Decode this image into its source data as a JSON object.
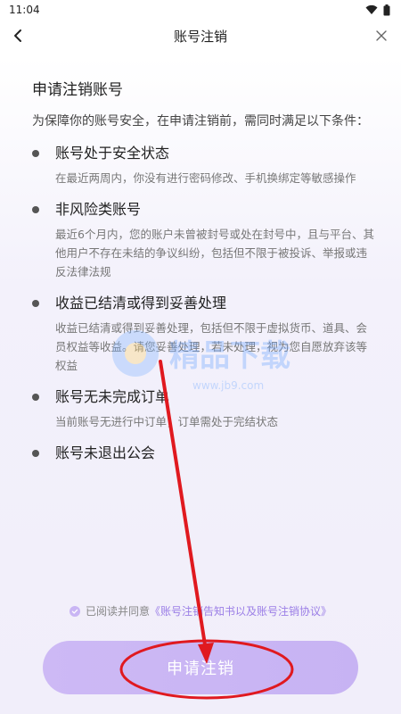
{
  "status_bar": {
    "time": "11:04"
  },
  "header": {
    "title": "账号注销"
  },
  "main": {
    "heading": "申请注销账号",
    "description": "为保障你的账号安全，在申请注销前，需同时满足以下条件：",
    "conditions": [
      {
        "title": "账号处于安全状态",
        "desc": "在最近两周内，你没有进行密码修改、手机换绑定等敏感操作"
      },
      {
        "title": "非风险类账号",
        "desc": "最近6个月内，您的账户未曾被封号或处在封号中，且与平台、其他用户不存在未结的争议纠纷，包括但不限于被投诉、举报或违反法律法规"
      },
      {
        "title": "收益已结清或得到妥善处理",
        "desc": "收益已结清或得到妥善处理，包括但不限于虚拟货币、道具、会员权益等收益。请您妥善处理，若未处理，视为您自愿放弃该等权益"
      },
      {
        "title": "账号无未完成订单",
        "desc": "当前账号无进行中订单，订单需处于完结状态"
      },
      {
        "title": "账号未退出公会",
        "desc": ""
      }
    ]
  },
  "agreement": {
    "prefix": "已阅读并同意",
    "link": "《账号注销告知书以及账号注销协议》"
  },
  "submit_button": {
    "label": "申请注销"
  },
  "watermark": {
    "text": "精品下载",
    "url": "www.jb9.com"
  },
  "colors": {
    "accent": "#9b7ee6",
    "button": "#c9b5f4",
    "annotation": "#e0191f"
  }
}
